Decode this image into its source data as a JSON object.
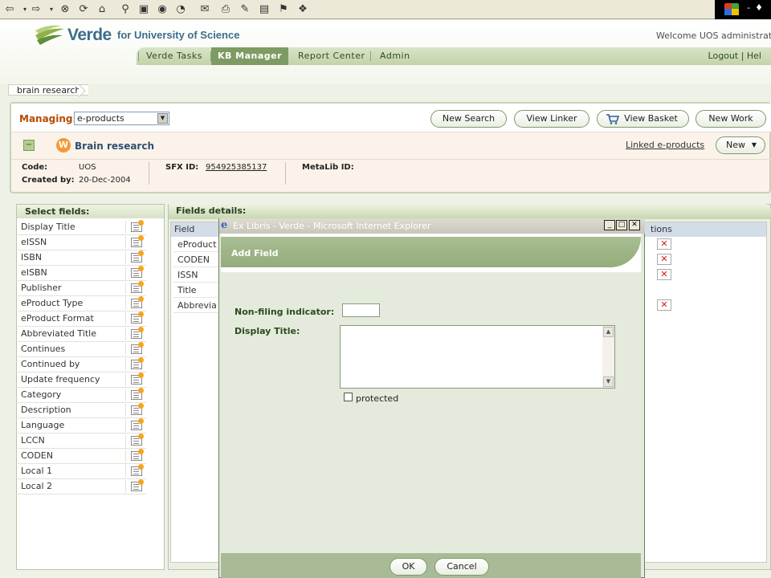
{
  "browser_toolbar": {
    "icons": [
      "back-icon",
      "forward-icon",
      "stop-icon",
      "refresh-icon",
      "home-icon",
      "search-icon",
      "favorites-icon",
      "media-icon",
      "history-icon",
      "mail-icon",
      "print-icon",
      "edit-icon",
      "discuss-icon",
      "research-icon"
    ]
  },
  "header": {
    "brand_name": "Verde",
    "brand_sub": "for University of Science",
    "welcome": "Welcome UOS administrato",
    "nav": [
      "Verde Tasks",
      "KB Manager",
      "Report Center",
      "Admin"
    ],
    "active_nav": "KB Manager",
    "logout": "Logout | Hel"
  },
  "breadcrumb": "brain research",
  "managing": {
    "label": "Managing:",
    "selected": "e-products",
    "buttons": {
      "new_search": "New Search",
      "view_linker": "View Linker",
      "view_basket": "View Basket",
      "new_work": "New Work"
    }
  },
  "record": {
    "type_badge": "W",
    "title": "Brain research",
    "linked": "Linked e-products",
    "new_label": "New",
    "code_label": "Code:",
    "code_value": "UOS",
    "created_label": "Created by:",
    "created_value": "20-Dec-2004",
    "sfx_label": "SFX ID:",
    "sfx_value": "954925385137",
    "metalib_label": "MetaLib ID:"
  },
  "select_fields": {
    "title": "Select fields:",
    "items": [
      "Display Title",
      "eISSN",
      "ISBN",
      "eISBN",
      "Publisher",
      "eProduct Type",
      "eProduct Format",
      "Abbreviated Title",
      "Continues",
      "Continued by",
      "Update frequency",
      "Category",
      "Description",
      "Language",
      "LCCN",
      "CODEN",
      "Local 1",
      "Local 2"
    ]
  },
  "fields_details": {
    "title": "Fields details:",
    "col_field": "Field",
    "col_actions": "tions",
    "rows": [
      "eProduct",
      "CODEN",
      "ISSN",
      "Title",
      "Abbrevia"
    ]
  },
  "popup": {
    "window_title": "Ex Libris - Verde - Microsoft Internet Explorer",
    "heading": "Add Field",
    "nfi_label": "Non-filing indicator:",
    "nfi_value": "",
    "display_title_label": "Display Title:",
    "display_title_value": "",
    "protected_label": "protected",
    "ok": "OK",
    "cancel": "Cancel"
  },
  "colors": {
    "accent_green": "#7e9b63",
    "managing_orange": "#b84a00",
    "title_blue": "#2f4e6f",
    "delete_red": "#d21b1b"
  }
}
